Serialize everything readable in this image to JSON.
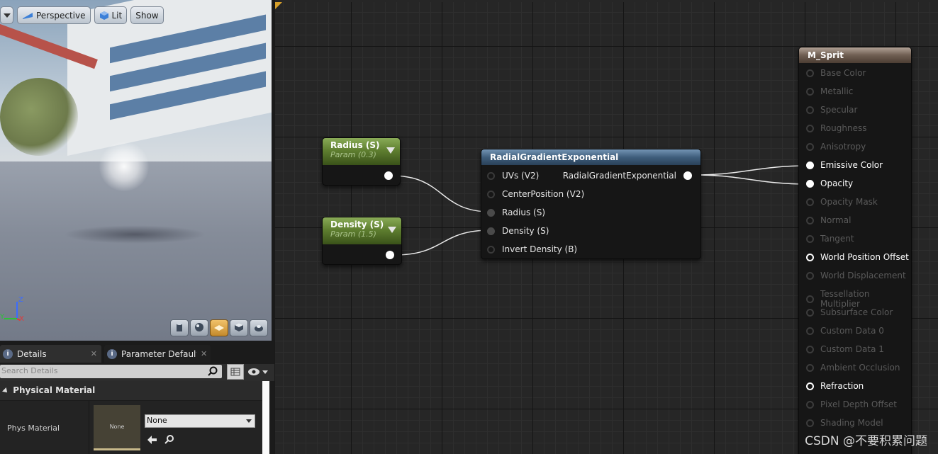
{
  "viewport": {
    "menu_label": "",
    "perspective_label": "Perspective",
    "lit_label": "Lit",
    "show_label": "Show",
    "axis_z": "Z",
    "axis_y": "Y",
    "axis_x": "X"
  },
  "details_panel": {
    "tabs": [
      {
        "label": "Details",
        "icon": "info-icon"
      },
      {
        "label": "Parameter Defaults",
        "icon": "info-icon"
      }
    ],
    "search_placeholder": "Search Details",
    "category_label": "Physical Material",
    "property_label": "Phys Material",
    "thumbnail_label": "None",
    "select_value": "None"
  },
  "graph": {
    "param_nodes": [
      {
        "title": "Radius (S)",
        "subtitle": "Param (0.3)",
        "value": 0.3
      },
      {
        "title": "Density (S)",
        "subtitle": "Param (1.5)",
        "value": 1.5
      }
    ],
    "function_node": {
      "title": "RadialGradientExponential",
      "inputs": [
        "UVs (V2)",
        "CenterPosition (V2)",
        "Radius (S)",
        "Density (S)",
        "Invert Density (B)"
      ],
      "output": "RadialGradientExponential"
    },
    "result_node": {
      "title": "M_Sprit",
      "pins": [
        {
          "label": "Base Color",
          "state": "inactive"
        },
        {
          "label": "Metallic",
          "state": "inactive"
        },
        {
          "label": "Specular",
          "state": "inactive"
        },
        {
          "label": "Roughness",
          "state": "inactive"
        },
        {
          "label": "Anisotropy",
          "state": "inactive"
        },
        {
          "label": "Emissive Color",
          "state": "connected"
        },
        {
          "label": "Opacity",
          "state": "connected"
        },
        {
          "label": "Opacity Mask",
          "state": "inactive"
        },
        {
          "label": "Normal",
          "state": "inactive"
        },
        {
          "label": "Tangent",
          "state": "inactive"
        },
        {
          "label": "World Position Offset",
          "state": "active"
        },
        {
          "label": "World Displacement",
          "state": "inactive"
        },
        {
          "label": "Tessellation Multiplier",
          "state": "inactive"
        },
        {
          "label": "Subsurface Color",
          "state": "inactive"
        },
        {
          "label": "Custom Data 0",
          "state": "inactive"
        },
        {
          "label": "Custom Data 1",
          "state": "inactive"
        },
        {
          "label": "Ambient Occlusion",
          "state": "inactive"
        },
        {
          "label": "Refraction",
          "state": "active"
        },
        {
          "label": "Pixel Depth Offset",
          "state": "inactive"
        },
        {
          "label": "Shading Model",
          "state": "inactive"
        }
      ]
    }
  },
  "watermark": "CSDN @不要积累问题",
  "colors": {
    "param_header": "#6b8c3a",
    "function_header": "#4a6a8a",
    "result_header": "#7a685a",
    "active_text": "#ffffff",
    "inactive_text": "#5a5a5a"
  }
}
